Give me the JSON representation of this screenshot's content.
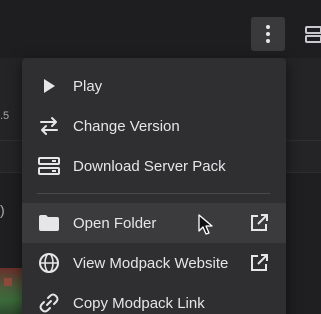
{
  "background": {
    "fragment_left_1": ".5",
    "fragment_left_2": ")"
  },
  "toolbar": {
    "kebab_icon": "vertical-dots-icon",
    "list_icon": "server-list-icon"
  },
  "menu": {
    "items": [
      {
        "label": "Play",
        "icon": "play-icon",
        "external": false
      },
      {
        "label": "Change Version",
        "icon": "swap-arrows-icon",
        "external": false
      },
      {
        "label": "Download Server Pack",
        "icon": "server-icon",
        "external": false
      },
      {
        "label": "Open Folder",
        "icon": "folder-icon",
        "external": true,
        "highlighted": true
      },
      {
        "label": "View Modpack Website",
        "icon": "globe-icon",
        "external": true
      },
      {
        "label": "Copy Modpack Link",
        "icon": "link-icon",
        "external": false
      }
    ]
  },
  "colors": {
    "menu_bg": "#2f2f31",
    "hover_bg": "#3b3b3e",
    "text": "#e6e6e9"
  }
}
